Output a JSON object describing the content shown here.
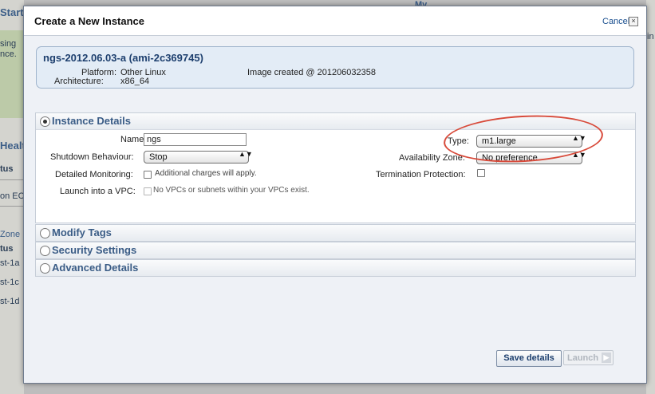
{
  "background": {
    "frag_started": "Start",
    "frag_sing": "sing",
    "frag_nce": "nce.",
    "frag_health": "Healt",
    "frag_tus1": "tus",
    "frag_on_ec": "on EC",
    "frag_zone": "Zone",
    "frag_tus2": "tus",
    "frag_st1a": "st-1a",
    "frag_st1c": "st-1c",
    "frag_st1d": "st-1d",
    "frag_my": "My",
    "frag_in": "in"
  },
  "dialog": {
    "title": "Create a New Instance",
    "cancel_label": "Cancel",
    "close_glyph": "×"
  },
  "ami": {
    "title": "ngs-2012.06.03-a (ami-2c369745)",
    "platform_label": "Platform:",
    "platform_value": "Other Linux",
    "image_created": "Image created @ 201206032358",
    "architecture_label": "Architecture:",
    "architecture_value": "x86_64"
  },
  "instance_details": {
    "header": "Instance Details",
    "name_label": "Name:",
    "name_value": "ngs",
    "shutdown_label": "Shutdown Behaviour:",
    "shutdown_value": "Stop",
    "monitoring_label": "Detailed Monitoring:",
    "monitoring_note": "Additional charges will apply.",
    "vpc_label": "Launch into a VPC:",
    "vpc_note": "No VPCs or subnets within your VPCs exist.",
    "type_label": "Type:",
    "type_value": "m1.large",
    "az_label": "Availability Zone:",
    "az_value": "No preference",
    "termination_label": "Termination Protection:"
  },
  "sections": {
    "modify_tags": "Modify Tags",
    "security_settings": "Security Settings",
    "advanced_details": "Advanced Details"
  },
  "footer": {
    "save_label": "Save details",
    "launch_label": "Launch",
    "launch_arrow": "▶"
  },
  "glyphs": {
    "select_arrows": "▲▼"
  },
  "colors": {
    "accent": "#3a5c86",
    "annotation": "#d84a3a"
  }
}
